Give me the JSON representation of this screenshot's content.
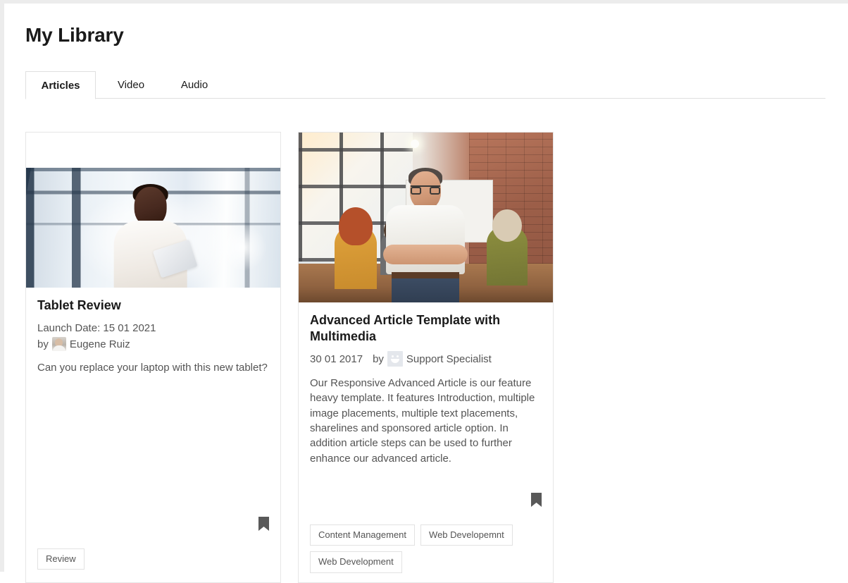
{
  "page": {
    "title": "My Library"
  },
  "tabs": [
    {
      "label": "Articles",
      "active": true
    },
    {
      "label": "Video",
      "active": false
    },
    {
      "label": "Audio",
      "active": false
    }
  ],
  "cards": [
    {
      "title": "Tablet Review",
      "date_label": "Launch Date: 15 01 2021",
      "by_label": "by",
      "author": "Eugene Ruiz",
      "author_avatar": "photo-avatar",
      "description": "Can you replace your laptop with this new tablet?",
      "bookmark_icon": "bookmark-icon",
      "tags": [
        "Review"
      ]
    },
    {
      "title": "Advanced Article Template with Multimedia",
      "date_label": "30 01 2017",
      "by_label": "by",
      "author": "Support Specialist",
      "author_avatar": "smiley-avatar",
      "description": "Our Responsive Advanced Article is our feature heavy template. It features Introduction, multiple image placements, multiple text placements, sharelines and sponsored article option. In addition article steps can be used to further enhance our advanced article.",
      "bookmark_icon": "bookmark-icon",
      "tags": [
        "Content Management",
        "Web Developemnt",
        "Web Development"
      ]
    }
  ],
  "colors": {
    "text_primary": "#1a1a1a",
    "text_secondary": "#555555",
    "border": "#e0e0e0",
    "card_border": "#e6e6e6",
    "bookmark": "#595959",
    "frame": "#ececec"
  }
}
